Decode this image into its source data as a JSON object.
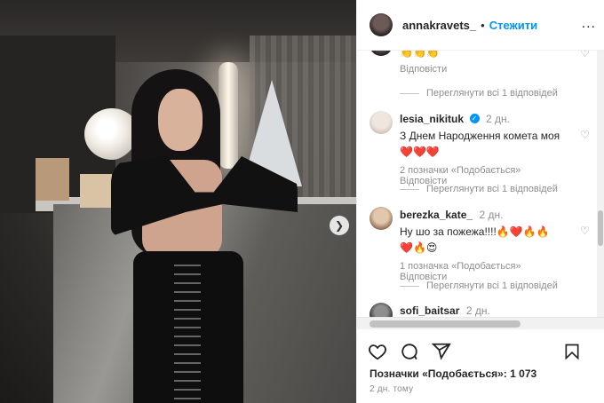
{
  "post": {
    "username": "annakravets_",
    "separator": "•",
    "follow_label": "Стежити",
    "more_label": "..."
  },
  "comments": [
    {
      "text": "👏👏👏",
      "reply_label": "Відповісти",
      "view_replies": "Переглянути всі 1 відповідей"
    },
    {
      "user": "lesia_nikituk",
      "verified": "✓",
      "time": "2 дн.",
      "text": "З Днем Народження комета моя",
      "text2": "❤️❤️❤️",
      "likes": "2 позначки «Подобається»",
      "reply_label": "Відповісти",
      "view_replies": "Переглянути всі 1 відповідей"
    },
    {
      "user": "berezka_kate_",
      "time": "2 дн.",
      "text": "Ну шо за пожежа!!!!🔥❤️🔥🔥",
      "text2": "❤️🔥😍",
      "likes": "1 позначка «Подобається»",
      "reply_label": "Відповісти",
      "view_replies": "Переглянути всі 1 відповідей"
    },
    {
      "user": "sofi_baitsar",
      "time": "2 дн."
    }
  ],
  "footer": {
    "likes_text": "Позначки «Подобається»: 1 073",
    "time_ago": "2 дн. тому"
  },
  "icons": {
    "heart": "heart-icon",
    "comment": "comment-icon",
    "share": "share-icon",
    "save": "bookmark-icon",
    "next": "chevron-right-icon"
  },
  "colors": {
    "link_blue": "#0095f6",
    "muted": "#8e8e8e",
    "text": "#262626"
  }
}
